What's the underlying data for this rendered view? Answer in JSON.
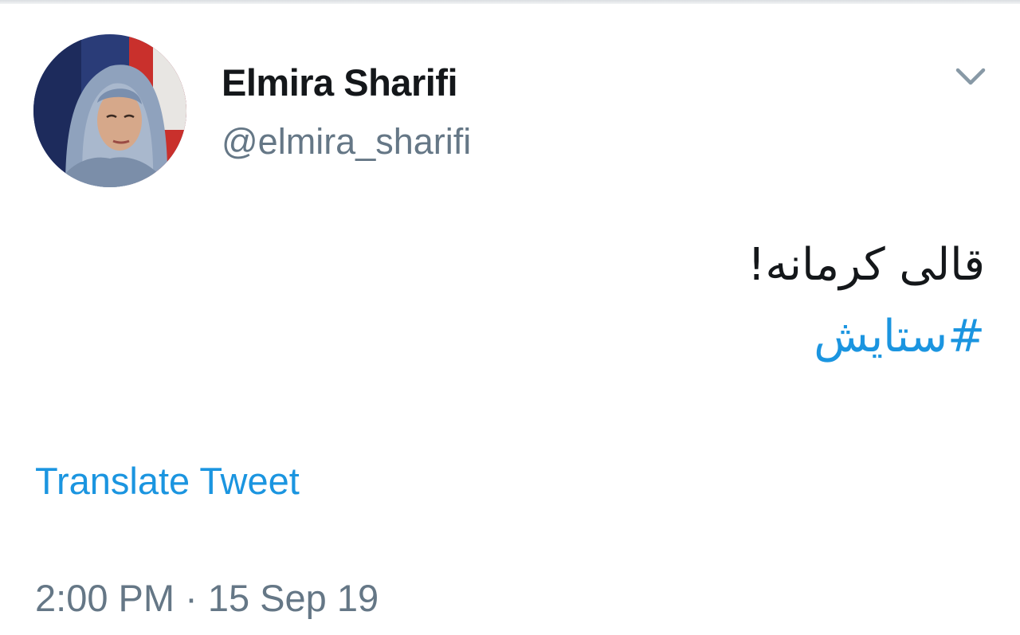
{
  "author": {
    "display_name": "Elmira Sharifi",
    "handle": "@elmira_sharifi"
  },
  "tweet": {
    "text": "قالی کرمانه!",
    "hashtag": "#ستایش"
  },
  "actions": {
    "translate_label": "Translate Tweet",
    "menu_icon": "chevron-down-icon"
  },
  "meta": {
    "time": "2:00 PM",
    "separator": "·",
    "date": "15 Sep 19"
  },
  "colors": {
    "link": "#1b95e0",
    "secondary_text": "#657786",
    "primary_text": "#14171a",
    "chevron": "#8899a6"
  }
}
